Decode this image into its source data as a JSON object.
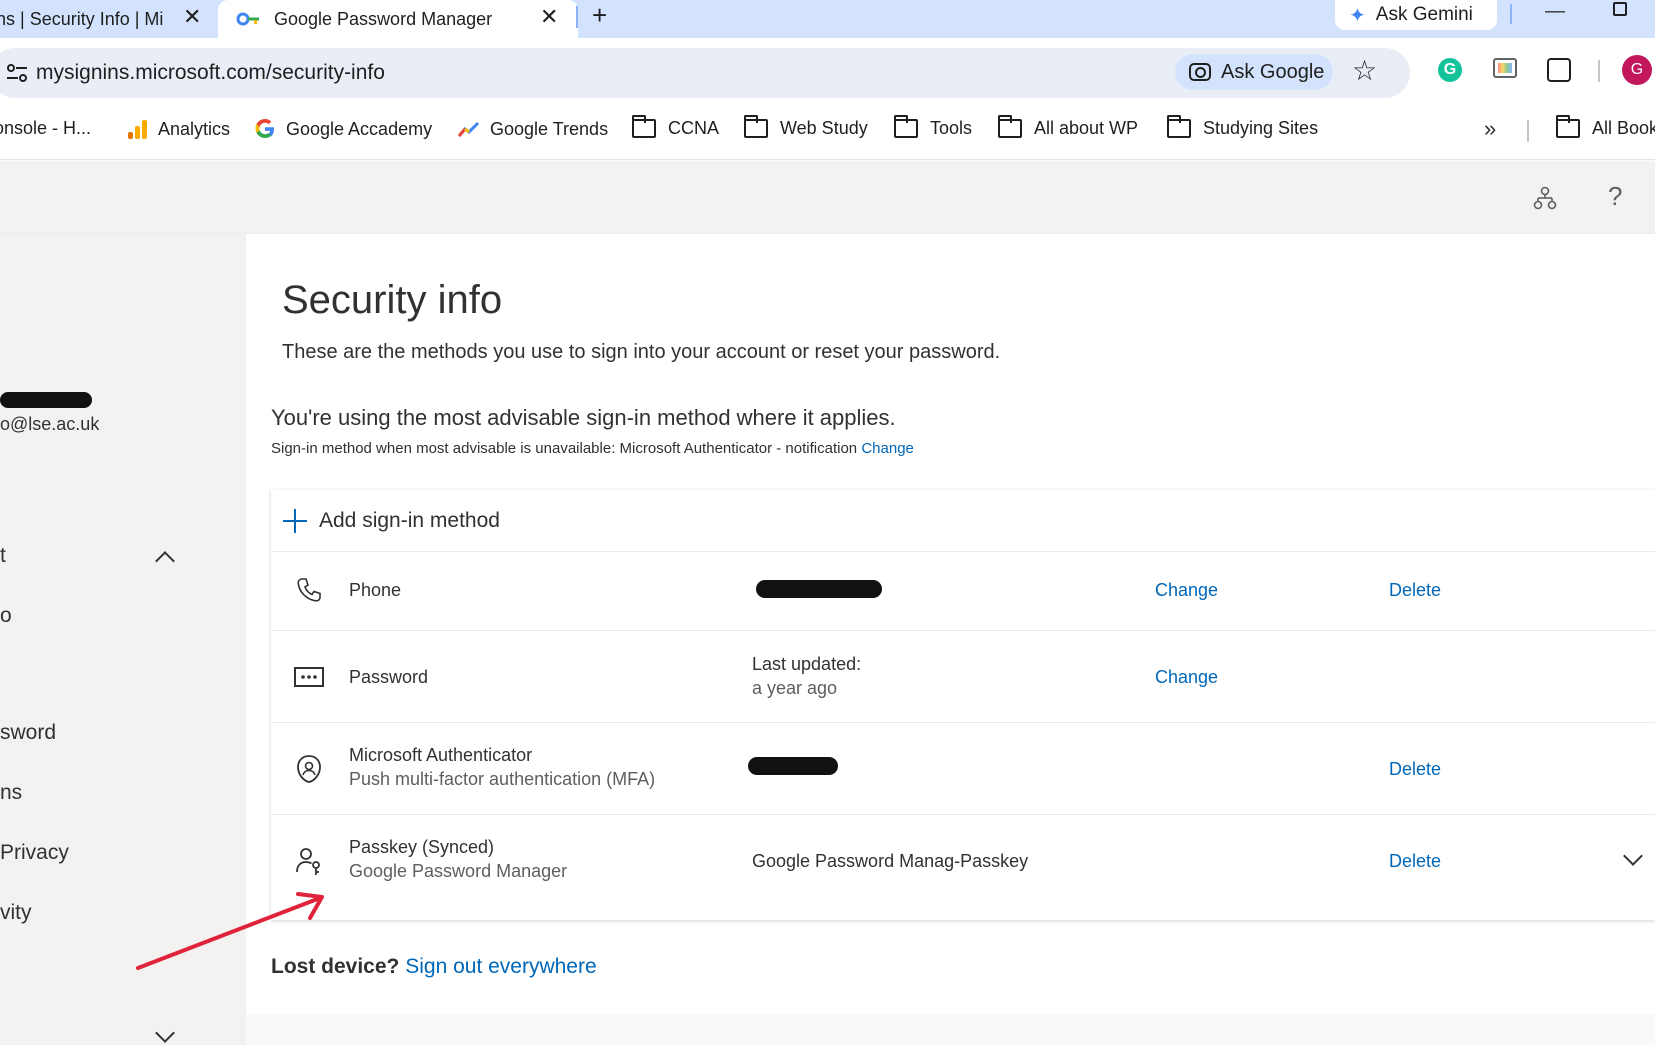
{
  "browser": {
    "tabs": [
      {
        "title": "ns | Security Info | Mic",
        "active": false
      },
      {
        "title": "Google Password Manager",
        "active": true
      }
    ],
    "new_tab_label": "+",
    "close_glyph": "✕",
    "gemini_label": "Ask Gemini",
    "address": "mysignins.microsoft.com/security-info",
    "ask_google_label": "Ask Google",
    "profile_initial": "G",
    "bookmarks": [
      {
        "label": "onsole - H...",
        "icon": "none"
      },
      {
        "label": "Analytics",
        "icon": "analytics-icon"
      },
      {
        "label": "Google Accademy",
        "icon": "google-icon"
      },
      {
        "label": "Google Trends",
        "icon": "trends-icon"
      },
      {
        "label": "CCNA",
        "icon": "folder-icon"
      },
      {
        "label": "Web Study",
        "icon": "folder-icon"
      },
      {
        "label": "Tools",
        "icon": "folder-icon"
      },
      {
        "label": "All about WP",
        "icon": "folder-icon"
      },
      {
        "label": "Studying Sites",
        "icon": "folder-icon"
      }
    ],
    "bookmarks_more": "»",
    "all_bookmarks": "All Book"
  },
  "header": {
    "help_glyph": "?"
  },
  "sidebar": {
    "email": "o@lse.ac.uk",
    "items": [
      "t",
      "o",
      "sword",
      "ns",
      "Privacy",
      "vity"
    ]
  },
  "main": {
    "title": "Security info",
    "subtitle": "These are the methods you use to sign into your account or reset your password.",
    "advisable": "You're using the most advisable sign-in method where it applies.",
    "advisable_sub": "Sign-in method when most advisable is unavailable: Microsoft Authenticator - notification",
    "advisable_change": "Change",
    "add_method": "Add sign-in method",
    "methods": [
      {
        "name": "Phone",
        "detail": "",
        "change": "Change",
        "delete": "Delete",
        "icon": "phone-icon"
      },
      {
        "name": "Password",
        "detail": "Last updated:",
        "detail_sub": "a year ago",
        "change": "Change",
        "icon": "password-icon"
      },
      {
        "name": "Microsoft Authenticator",
        "sub": "Push multi-factor authentication (MFA)",
        "delete": "Delete",
        "icon": "authenticator-icon"
      },
      {
        "name": "Passkey (Synced)",
        "sub": "Google Password Manager",
        "detail": "Google Password Manag-Passkey",
        "delete": "Delete",
        "icon": "passkey-icon"
      }
    ],
    "lost_device": "Lost device?",
    "sign_out_everywhere": "Sign out everywhere"
  },
  "colors": {
    "link": "#0067b8",
    "annotation_arrow": "#e0223a",
    "tab_bar": "#d3e3fd"
  }
}
